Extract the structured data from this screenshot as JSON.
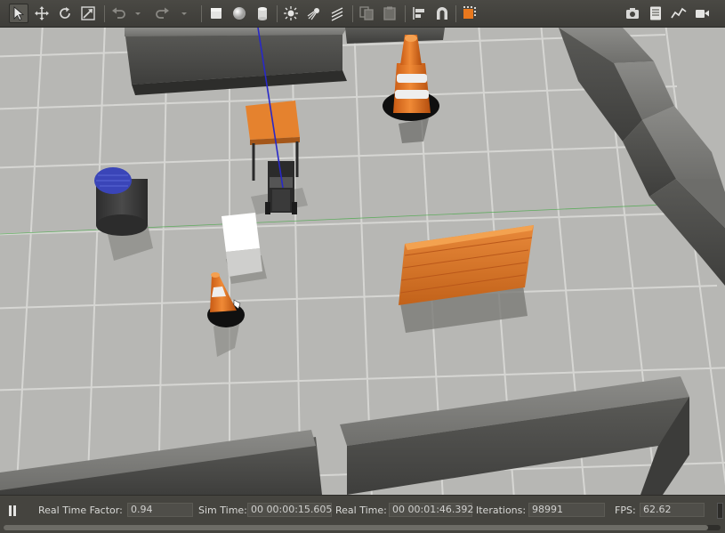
{
  "toolbar": {
    "tools": [
      {
        "name": "select-mode-icon",
        "active": true
      },
      {
        "name": "translate-mode-icon"
      },
      {
        "name": "rotate-mode-icon"
      },
      {
        "name": "scale-mode-icon"
      },
      {
        "name": "undo-icon"
      },
      {
        "name": "undo-dropdown-icon"
      },
      {
        "name": "redo-icon"
      },
      {
        "name": "redo-dropdown-icon"
      },
      {
        "name": "box-shape-icon"
      },
      {
        "name": "sphere-shape-icon"
      },
      {
        "name": "cylinder-shape-icon"
      },
      {
        "name": "point-light-icon"
      },
      {
        "name": "spot-light-icon"
      },
      {
        "name": "directional-light-icon"
      },
      {
        "name": "copy-icon"
      },
      {
        "name": "paste-icon"
      },
      {
        "name": "align-icon"
      },
      {
        "name": "snap-icon"
      },
      {
        "name": "change-view-icon"
      },
      {
        "name": "screenshot-icon"
      },
      {
        "name": "log-data-icon"
      },
      {
        "name": "plot-icon"
      },
      {
        "name": "video-record-icon"
      }
    ]
  },
  "colors": {
    "accent_orange": "#e8781e",
    "floor": "#b7b7b4",
    "grid": "#d6d6d3",
    "wall": "#8a8a87",
    "panel": "#45443f"
  },
  "status": {
    "rtf_label": "Real Time Factor:",
    "rtf_value": "0.94",
    "sim_time_label": "Sim Time:",
    "sim_time_value": "00 00:00:15.605",
    "real_time_label": "Real Time:",
    "real_time_value": "00 00:01:46.392",
    "iterations_label": "Iterations:",
    "iterations_value": "98991",
    "fps_label": "FPS:",
    "fps_value": "62.62"
  }
}
